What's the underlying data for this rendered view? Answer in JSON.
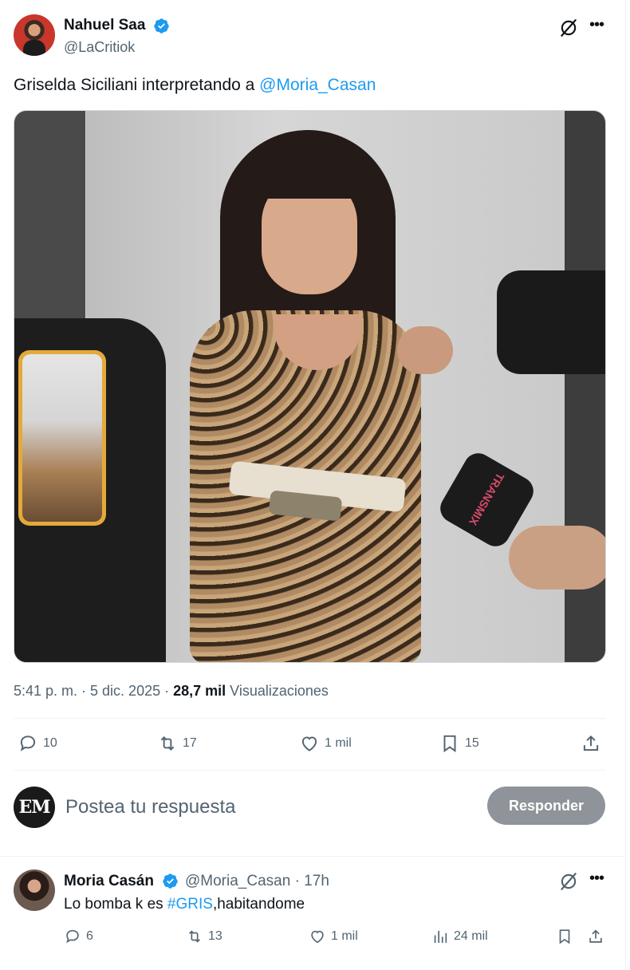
{
  "tweet": {
    "author_name": "Nahuel Saa",
    "author_handle": "@LaCritiok",
    "text_prefix": "Griselda Siciliani interpretando a ",
    "mention": "@Moria_Casan",
    "media_caption": "TRANSMIX",
    "timestamp": "5:41 p. m. · 5 dic. 2025 · ",
    "views_count": "28,7 mil",
    "views_label": " Visualizaciones",
    "actions": {
      "replies": "10",
      "reposts": "17",
      "likes": "1 mil",
      "bookmarks": "15"
    }
  },
  "composer": {
    "avatar_text": "EM",
    "placeholder": "Postea tu respuesta",
    "button_label": "Responder"
  },
  "reply": {
    "author_name": "Moria Casán",
    "author_handle": "@Moria_Casan",
    "age": " · 17h",
    "text_prefix": "Lo bomba k es ",
    "hashtag": "#GRIS",
    "text_suffix": ",habitandome",
    "actions": {
      "replies": "6",
      "reposts": "13",
      "likes": "1 mil",
      "views": "24 mil"
    }
  },
  "colors": {
    "accent": "#1d9bf0",
    "text": "#0f1419",
    "muted": "#536471",
    "button_disabled": "#8e9499"
  }
}
